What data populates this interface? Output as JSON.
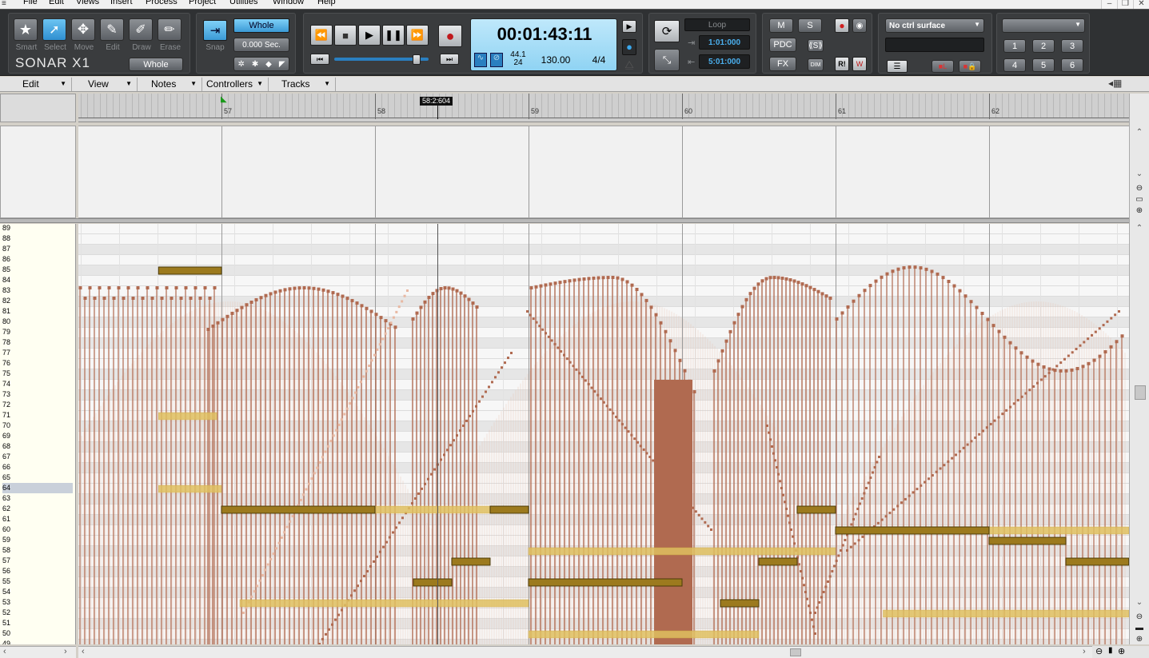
{
  "app": {
    "logo": "SONAR X1"
  },
  "menubar": {
    "items": [
      "File",
      "Edit",
      "Views",
      "Insert",
      "Process",
      "Project",
      "Utilities",
      "Window",
      "Help"
    ]
  },
  "tools": {
    "items": [
      {
        "name": "smart",
        "label": "Smart",
        "glyph": "★"
      },
      {
        "name": "select",
        "label": "Select",
        "glyph": "➚"
      },
      {
        "name": "move",
        "label": "Move",
        "glyph": "✥"
      },
      {
        "name": "edit",
        "label": "Edit",
        "glyph": "✎"
      },
      {
        "name": "draw",
        "label": "Draw",
        "glyph": "✐"
      },
      {
        "name": "erase",
        "label": "Erase",
        "glyph": "✏"
      }
    ],
    "duration_label": "Whole"
  },
  "snap": {
    "label": "Snap",
    "value": "Whole",
    "offset": "0.000 Sec."
  },
  "transport": {
    "time": "00:01:43:11",
    "sample_rate": "44.1",
    "bit_depth": "24",
    "tempo": "130.00",
    "meter": "4/4"
  },
  "loop": {
    "title": "Loop",
    "start": "1:01:000",
    "end": "5:01:000"
  },
  "mix": {
    "mute": "M",
    "solo": "S",
    "pdc": "PDC",
    "fx": "FX",
    "dim": "DIM",
    "read": "R!",
    "write": "W"
  },
  "surface": {
    "selected": "No ctrl surface"
  },
  "screensets": {
    "buttons": [
      "1",
      "2",
      "3",
      "4",
      "5",
      "6"
    ]
  },
  "pianoroll_menu": {
    "items": [
      "Edit",
      "View",
      "Notes",
      "Controllers",
      "Tracks"
    ]
  },
  "ruler": {
    "bars": [
      "57",
      "58",
      "59",
      "60",
      "61",
      "62"
    ],
    "now_marker": "58:2:604"
  },
  "piano_keys": {
    "labels": [
      "89",
      "88",
      "87",
      "86",
      "85",
      "84",
      "83",
      "82",
      "81",
      "80",
      "79",
      "78",
      "77",
      "76",
      "75",
      "74",
      "73",
      "72",
      "71",
      "70",
      "69",
      "68",
      "67",
      "66",
      "65",
      "64",
      "63",
      "62",
      "61",
      "60",
      "59",
      "58",
      "57",
      "56",
      "55",
      "54",
      "53",
      "52",
      "51",
      "50",
      "49"
    ],
    "highlighted": "64"
  },
  "colors": {
    "selected_note": "#9c7a1e",
    "ghost_note": "#e0c060",
    "melody": "#b06a50",
    "melody_light": "#e8b8a2"
  },
  "notes_selected": [
    {
      "pitch": 85,
      "start": 56.59,
      "end": 57.0
    },
    {
      "pitch": 62,
      "start": 57.0,
      "end": 58.0
    },
    {
      "pitch": 62,
      "start": 58.75,
      "end": 59.0
    },
    {
      "pitch": 55,
      "start": 58.25,
      "end": 58.5
    },
    {
      "pitch": 57,
      "start": 58.5,
      "end": 58.75
    },
    {
      "pitch": 55,
      "start": 59.0,
      "end": 60.0
    },
    {
      "pitch": 53,
      "start": 60.25,
      "end": 60.5
    },
    {
      "pitch": 57,
      "start": 60.5,
      "end": 60.75
    },
    {
      "pitch": 62,
      "start": 60.75,
      "end": 61.0
    },
    {
      "pitch": 60,
      "start": 61.0,
      "end": 62.0
    },
    {
      "pitch": 59,
      "start": 62.0,
      "end": 62.5
    },
    {
      "pitch": 57,
      "start": 62.5,
      "end": 62.91
    }
  ],
  "notes_ghost": [
    {
      "pitch": 71,
      "start": 56.59,
      "end": 56.97
    },
    {
      "pitch": 64,
      "start": 56.59,
      "end": 57.0
    },
    {
      "pitch": 62,
      "start": 58.0,
      "end": 58.75
    },
    {
      "pitch": 58,
      "start": 59.0,
      "end": 61.0
    },
    {
      "pitch": 53,
      "start": 57.12,
      "end": 59.0
    },
    {
      "pitch": 50,
      "start": 59.0,
      "end": 60.5
    },
    {
      "pitch": 60,
      "start": 62.0,
      "end": 62.91
    },
    {
      "pitch": 52,
      "start": 61.31,
      "end": 62.91
    }
  ]
}
